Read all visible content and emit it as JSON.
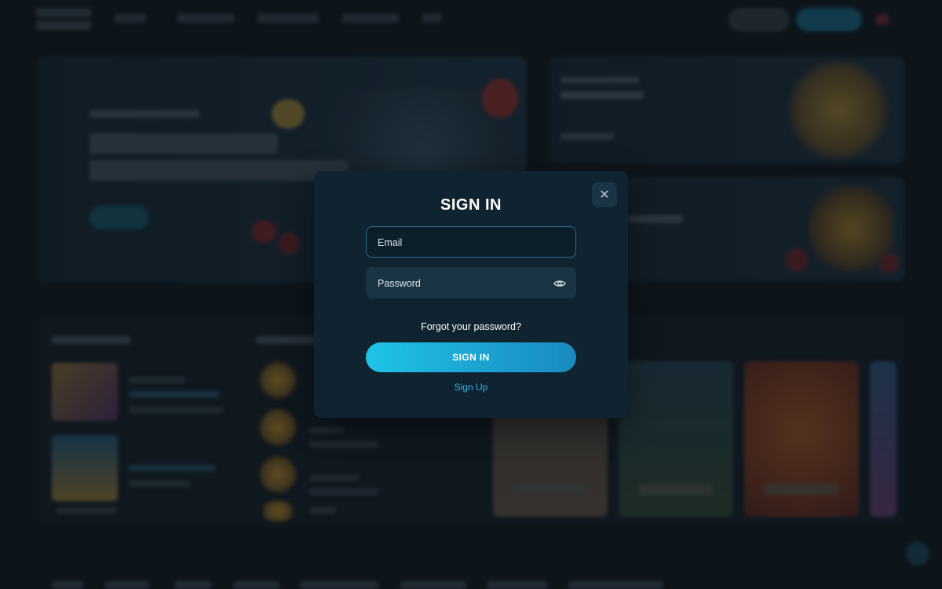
{
  "modal": {
    "title": "SIGN IN",
    "email_placeholder": "Email",
    "password_placeholder": "Password",
    "forgot_label": "Forgot your password?",
    "submit_label": "SIGN IN",
    "signup_label": "Sign Up",
    "close_glyph": "✕"
  },
  "icons": {
    "close": "close-icon",
    "password_visibility": "eye-icon"
  },
  "colors": {
    "accent": "#1fc3e6",
    "accent_dark": "#1a8ac0",
    "modal_bg": "#0f2331",
    "page_bg": "#131b23",
    "link": "#29b4e2"
  }
}
